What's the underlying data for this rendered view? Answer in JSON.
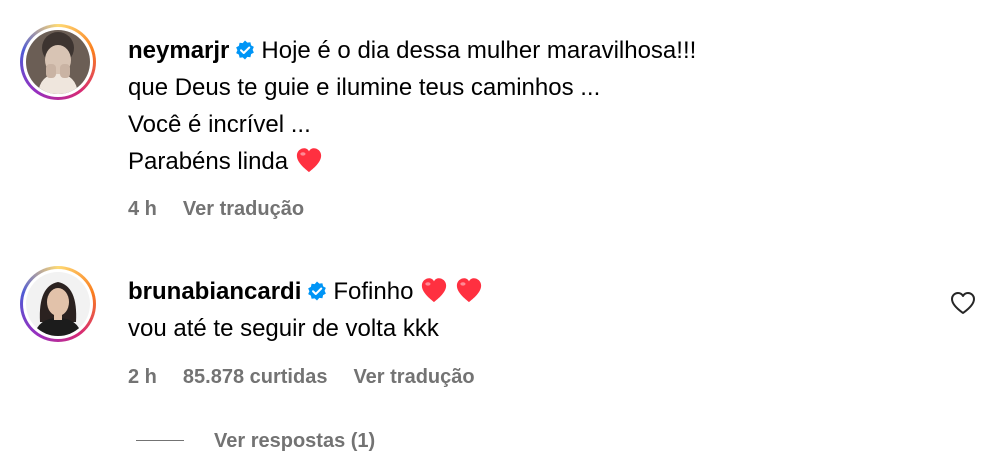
{
  "comments": [
    {
      "username": "neymarjr",
      "verified": true,
      "lines": [
        "Hoje é o dia dessa mulher maravilhosa!!!",
        "que Deus te guie e ilumine teus caminhos ...",
        "Você é incrível ...",
        "Parabéns linda"
      ],
      "time": "4 h",
      "translate": "Ver tradução"
    },
    {
      "username": "brunabiancardi",
      "verified": true,
      "lines": [
        "Fofinho",
        "vou até te seguir de volta kkk"
      ],
      "time": "2 h",
      "likes": "85.878 curtidas",
      "translate": "Ver tradução"
    }
  ],
  "replies_label": "Ver respostas (1)",
  "colors": {
    "verified": "#0095f6",
    "heart": "#ff3040",
    "meta": "#737373"
  },
  "icons": [
    "verified-badge-icon",
    "heart-emoji-icon",
    "like-heart-outline-icon"
  ]
}
